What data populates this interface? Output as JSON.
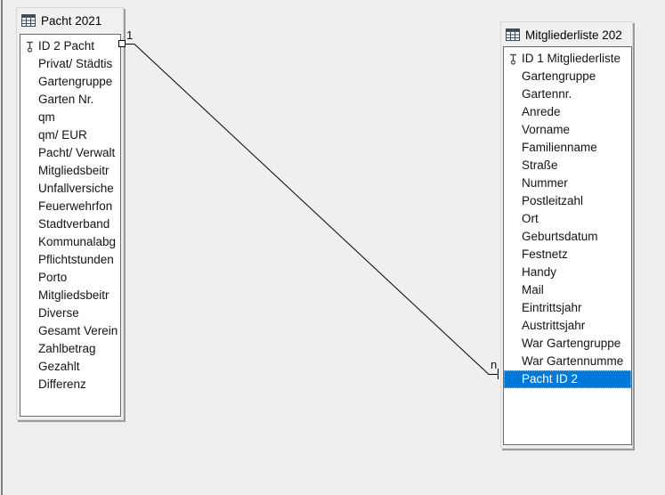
{
  "app": {
    "view": "relation-design-canvas",
    "background_color": "#efefef",
    "selection_color": "#0078d7",
    "line_color": "#000000"
  },
  "relationship": {
    "cardinality_one": "1",
    "cardinality_many": "n",
    "from_table": "Pacht 2021",
    "from_field": "ID 2 Pacht",
    "to_table": "Mitgliederliste 202",
    "to_field": "Pacht ID 2"
  },
  "tables": [
    {
      "title": "Pacht 2021",
      "key_index": 0,
      "selected_index": -1,
      "fields": [
        "ID 2 Pacht",
        "Privat/ Städtis",
        "Gartengruppe",
        "Garten Nr.",
        "qm",
        "qm/ EUR",
        "Pacht/ Verwalt",
        "Mitgliedsbeitr",
        "Unfallversiche",
        "Feuerwehrfon",
        "Stadtverband",
        "Kommunalabg",
        "Pflichtstunden",
        "Porto",
        "Mitgliedsbeitr",
        "Diverse",
        "Gesamt Verein",
        "Zahlbetrag",
        "Gezahlt",
        "Differenz"
      ]
    },
    {
      "title": "Mitgliederliste 202",
      "key_index": 0,
      "selected_index": 18,
      "fields": [
        "ID 1 Mitgliederliste",
        "Gartengruppe",
        "Gartennr.",
        "Anrede",
        "Vorname",
        "Familienname",
        "Straße",
        "Nummer",
        "Postleitzahl",
        "Ort",
        "Geburtsdatum",
        "Festnetz",
        "Handy",
        "Mail",
        "Eintrittsjahr",
        "Austrittsjahr",
        "War Gartengruppe",
        "War Gartennumme",
        "Pacht ID 2"
      ]
    }
  ]
}
